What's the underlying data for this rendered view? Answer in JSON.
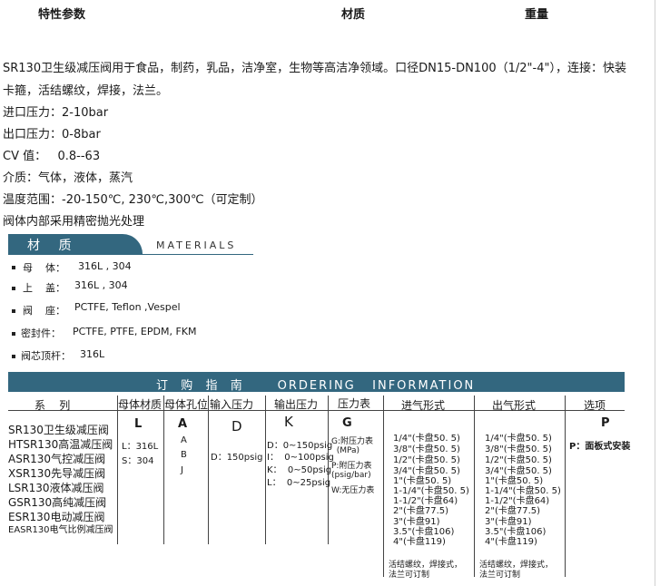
{
  "header": {
    "col1": "特性参数",
    "col2": "材质",
    "col3": "重量"
  },
  "description": {
    "intro_line1": "SR130卫生级减压阀用于食品，制药，乳品，洁净室，生物等高洁净领域。口径DN15-DN100（1/2\"-4\"），连接：快装",
    "intro_line2": "卡箍，活结螺纹，焊接，法兰。",
    "inlet_pressure": "进口压力：2-10bar",
    "outlet_pressure": "出口压力：0-8bar",
    "cv": "CV 值：   0.8--63",
    "medium": "介质：气体，液体，蒸汽",
    "temperature": "温度范围：-20-150℃, 230℃,300℃（可定制）",
    "polish": "阀体内部采用精密抛光处理"
  },
  "materials": {
    "title": "材  质",
    "title_en": "MATERIALS",
    "rows": [
      {
        "label": "母    体：",
        "value": "316L , 304"
      },
      {
        "label": "上    盖：",
        "value": "316L , 304"
      },
      {
        "label": "阀    座：",
        "value": "PCTFE,  Teflon ,Vespel"
      },
      {
        "label": "密封件：",
        "value": "PCTFE, PTFE, EPDM, FKM"
      },
      {
        "label": "阀芯顶杆：",
        "value": "316L"
      }
    ]
  },
  "ordering": {
    "title": "订  购  指  南      ORDERING   INFORMATION",
    "columns": {
      "series": "系    列",
      "body_material": "母体材质",
      "body_orifice": "母体孔位",
      "inlet_pressure": "输入压力",
      "outlet_pressure": "输出压力",
      "gauge": "压力表",
      "inlet_form": "进气形式",
      "outlet_form": "出气形式",
      "options": "选项"
    },
    "series_list": [
      "SR130卫生级减压阀",
      "HTSR130高温减压阀",
      "ASR130气控减压阀",
      "XSR130先导减压阀",
      "LSR130液体减压阀",
      "GSR130高纯减压阀",
      "ESR130电动减压阀",
      "EASR130电气比例减压阀"
    ],
    "body_material": {
      "code": "L",
      "items": [
        "L：316L",
        "S：304"
      ]
    },
    "body_orifice": {
      "code": "A",
      "items": [
        "A",
        "B",
        "J"
      ]
    },
    "inlet_pressure": {
      "code": "D",
      "items": [
        "D：150psig"
      ]
    },
    "outlet_pressure": {
      "code": "K",
      "items": [
        "D：0~150psig",
        "I：  0~100psig",
        "K：  0~50psig",
        "L：  0~25psig"
      ]
    },
    "gauge": {
      "code": "G",
      "items": [
        "G:附压力表",
        "  (MPa)",
        "P:附压力表",
        "(psig/bar)",
        "W:无压力表"
      ]
    },
    "inlet_form": {
      "items": [
        "1/4\"(卡盘50. 5)",
        "3/8\"(卡盘50. 5)",
        "1/2\"(卡盘50. 5)",
        "3/4\"(卡盘50. 5)",
        "1\"(卡盘50. 5)",
        "1-1/4\"(卡盘50. 5)",
        "1-1/2\"(卡盘64)",
        "2\"(卡盘77.5)",
        "3\"(卡盘91)",
        "3.5\"(卡盘106)",
        "4\"(卡盘119)"
      ],
      "note_line1": "活结螺纹，焊接式，",
      "note_line2": "法兰可订制"
    },
    "outlet_form": {
      "items": [
        "1/4\"(卡盘50. 5)",
        "3/8\"(卡盘50. 5)",
        "1/2\"(卡盘50. 5)",
        "3/4\"(卡盘50. 5)",
        "1\"(卡盘50. 5)",
        "1-1/4\"(卡盘50. 5)",
        "1-1/2\"(卡盘64)",
        "2\"(卡盘77.5)",
        "3\"(卡盘91)",
        "3.5\"(卡盘106)",
        "4\"(卡盘119)"
      ],
      "note_line1": "活结螺纹，焊接式，",
      "note_line2": "法兰可订制"
    },
    "options": {
      "code": "P",
      "items": [
        "P：面板式安装"
      ]
    }
  }
}
